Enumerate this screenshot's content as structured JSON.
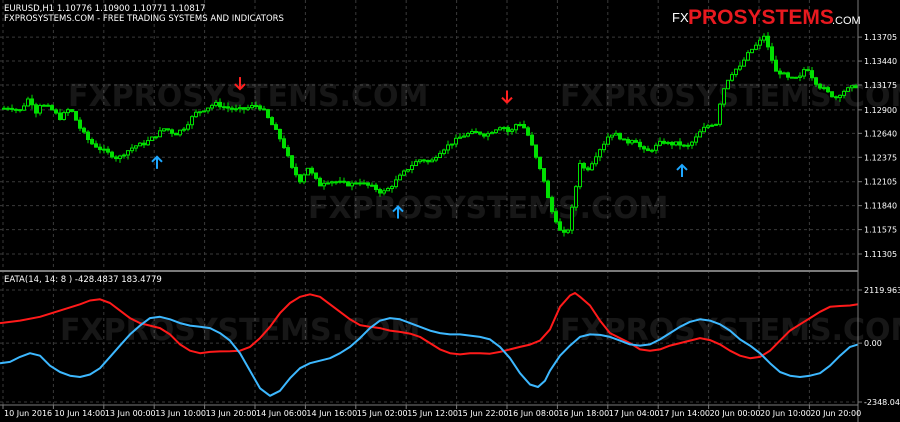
{
  "header": {
    "symbol_line": "EURUSD,H1  1.10776 1.10900 1.10771 1.10817",
    "site_line": "FXPROSYSTEMS.COM - FREE TRADING SYSTEMS AND INDICATORS"
  },
  "logo": {
    "fx": "FX",
    "pro": "PROSYSTEMS",
    "com": ".COM"
  },
  "watermark": "FXPROSYSTEMS.COM",
  "indicator": {
    "label": "EATA(14, 14: 8 ) -428.4837 183.4779"
  },
  "colors": {
    "background": "#000000",
    "grid": "#3a3a3a",
    "candle": "#00e000",
    "buy_arrow": "#1ea7ff",
    "sell_arrow": "#ff2020",
    "red_line": "#ff1a1a",
    "blue_line": "#3db8ff",
    "logo_red": "#e8191f"
  },
  "chart_data": [
    {
      "type": "candlestick",
      "title": "EURUSD,H1",
      "ylim": [
        1.1115,
        1.1385
      ],
      "y_ticks": [
        "1.13705",
        "1.13440",
        "1.13175",
        "1.12900",
        "1.12640",
        "1.12375",
        "1.12105",
        "1.11840",
        "1.11575",
        "1.11305"
      ],
      "close_path": [
        [
          0,
          1.1291
        ],
        [
          10,
          1.1293
        ],
        [
          20,
          1.1289
        ],
        [
          30,
          1.1305
        ],
        [
          35,
          1.1286
        ],
        [
          40,
          1.1296
        ],
        [
          50,
          1.1292
        ],
        [
          60,
          1.1281
        ],
        [
          70,
          1.1292
        ],
        [
          80,
          1.127
        ],
        [
          90,
          1.1254
        ],
        [
          100,
          1.1247
        ],
        [
          110,
          1.1241
        ],
        [
          118,
          1.1236
        ],
        [
          125,
          1.1243
        ],
        [
          135,
          1.125
        ],
        [
          145,
          1.1253
        ],
        [
          155,
          1.1261
        ],
        [
          165,
          1.127
        ],
        [
          175,
          1.1263
        ],
        [
          185,
          1.1271
        ],
        [
          195,
          1.1286
        ],
        [
          205,
          1.1291
        ],
        [
          215,
          1.1297
        ],
        [
          225,
          1.1293
        ],
        [
          235,
          1.129
        ],
        [
          245,
          1.1291
        ],
        [
          255,
          1.1295
        ],
        [
          262,
          1.1292
        ],
        [
          270,
          1.1277
        ],
        [
          278,
          1.1263
        ],
        [
          285,
          1.1247
        ],
        [
          292,
          1.1225
        ],
        [
          300,
          1.1212
        ],
        [
          308,
          1.1226
        ],
        [
          315,
          1.1214
        ],
        [
          320,
          1.1207
        ],
        [
          325,
          1.1211
        ],
        [
          333,
          1.1211
        ],
        [
          342,
          1.1209
        ],
        [
          350,
          1.1207
        ],
        [
          358,
          1.1211
        ],
        [
          366,
          1.1207
        ],
        [
          374,
          1.1204
        ],
        [
          382,
          1.1198
        ],
        [
          390,
          1.1204
        ],
        [
          398,
          1.1214
        ],
        [
          406,
          1.1223
        ],
        [
          414,
          1.1231
        ],
        [
          422,
          1.1236
        ],
        [
          430,
          1.1231
        ],
        [
          438,
          1.1242
        ],
        [
          446,
          1.1249
        ],
        [
          454,
          1.1255
        ],
        [
          462,
          1.1261
        ],
        [
          470,
          1.1264
        ],
        [
          478,
          1.1265
        ],
        [
          486,
          1.1262
        ],
        [
          494,
          1.1268
        ],
        [
          502,
          1.1273
        ],
        [
          510,
          1.1264
        ],
        [
          518,
          1.1277
        ],
        [
          526,
          1.1268
        ],
        [
          532,
          1.125
        ],
        [
          538,
          1.123
        ],
        [
          544,
          1.1212
        ],
        [
          550,
          1.1182
        ],
        [
          556,
          1.1168
        ],
        [
          562,
          1.115
        ],
        [
          568,
          1.1158
        ],
        [
          574,
          1.1192
        ],
        [
          580,
          1.1232
        ],
        [
          586,
          1.1222
        ],
        [
          592,
          1.1232
        ],
        [
          598,
          1.1244
        ],
        [
          604,
          1.1253
        ],
        [
          610,
          1.1264
        ],
        [
          618,
          1.1262
        ],
        [
          626,
          1.1253
        ],
        [
          634,
          1.1259
        ],
        [
          640,
          1.1249
        ],
        [
          646,
          1.1243
        ],
        [
          654,
          1.1248
        ],
        [
          662,
          1.1255
        ],
        [
          670,
          1.1252
        ],
        [
          678,
          1.1253
        ],
        [
          686,
          1.1248
        ],
        [
          694,
          1.1256
        ],
        [
          702,
          1.1268
        ],
        [
          710,
          1.1274
        ],
        [
          716,
          1.1275
        ],
        [
          722,
          1.1309
        ],
        [
          728,
          1.1324
        ],
        [
          734,
          1.1334
        ],
        [
          740,
          1.1337
        ],
        [
          746,
          1.1349
        ],
        [
          752,
          1.1357
        ],
        [
          758,
          1.1363
        ],
        [
          764,
          1.1372
        ],
        [
          770,
          1.1352
        ],
        [
          776,
          1.1332
        ],
        [
          782,
          1.1331
        ],
        [
          788,
          1.1325
        ],
        [
          794,
          1.1324
        ],
        [
          800,
          1.1326
        ],
        [
          806,
          1.1339
        ],
        [
          812,
          1.1327
        ],
        [
          818,
          1.1317
        ],
        [
          824,
          1.1313
        ],
        [
          830,
          1.1307
        ],
        [
          836,
          1.1304
        ],
        [
          842,
          1.131
        ],
        [
          850,
          1.1314
        ],
        [
          858,
          1.1317
        ]
      ],
      "buy_arrows": [
        [
          157,
          1.1238
        ],
        [
          398,
          1.1183
        ],
        [
          682,
          1.1229
        ]
      ],
      "sell_arrows": [
        [
          240,
          1.1313
        ],
        [
          507,
          1.1298
        ]
      ]
    },
    {
      "type": "line",
      "title": "EATA(14, 14: 8 )",
      "ylim": [
        -2348.042,
        2119.963
      ],
      "y_ticks": [
        "2119.963",
        "0.00",
        "-2348.042"
      ],
      "x_tick_labels": [
        "10 Jun 2016",
        "10 Jun 14:00",
        "13 Jun 00:00",
        "13 Jun 10:00",
        "13 Jun 20:00",
        "14 Jun 06:00",
        "14 Jun 16:00",
        "15 Jun 02:00",
        "15 Jun 12:00",
        "15 Jun 22:00",
        "16 Jun 08:00",
        "16 Jun 18:00",
        "17 Jun 04:00",
        "17 Jun 14:00",
        "20 Jun 00:00",
        "20 Jun 10:00",
        "20 Jun 20:00"
      ],
      "series": [
        {
          "color": "red",
          "points": [
            [
              0,
              800
            ],
            [
              20,
              900
            ],
            [
              40,
              1050
            ],
            [
              60,
              1300
            ],
            [
              80,
              1550
            ],
            [
              90,
              1700
            ],
            [
              100,
              1750
            ],
            [
              110,
              1600
            ],
            [
              120,
              1300
            ],
            [
              130,
              1000
            ],
            [
              140,
              800
            ],
            [
              150,
              700
            ],
            [
              160,
              600
            ],
            [
              170,
              350
            ],
            [
              180,
              -50
            ],
            [
              190,
              -300
            ],
            [
              200,
              -400
            ],
            [
              210,
              -350
            ],
            [
              220,
              -330
            ],
            [
              230,
              -320
            ],
            [
              240,
              -300
            ],
            [
              250,
              -150
            ],
            [
              260,
              200
            ],
            [
              270,
              650
            ],
            [
              280,
              1200
            ],
            [
              290,
              1600
            ],
            [
              300,
              1850
            ],
            [
              310,
              1950
            ],
            [
              320,
              1850
            ],
            [
              330,
              1550
            ],
            [
              340,
              1250
            ],
            [
              350,
              950
            ],
            [
              360,
              720
            ],
            [
              370,
              650
            ],
            [
              380,
              600
            ],
            [
              390,
              500
            ],
            [
              400,
              450
            ],
            [
              410,
              380
            ],
            [
              420,
              250
            ],
            [
              430,
              0
            ],
            [
              440,
              -250
            ],
            [
              450,
              -400
            ],
            [
              460,
              -450
            ],
            [
              470,
              -400
            ],
            [
              480,
              -400
            ],
            [
              490,
              -420
            ],
            [
              500,
              -350
            ],
            [
              510,
              -250
            ],
            [
              520,
              -150
            ],
            [
              530,
              -60
            ],
            [
              540,
              100
            ],
            [
              550,
              550
            ],
            [
              560,
              1450
            ],
            [
              570,
              1900
            ],
            [
              575,
              2000
            ],
            [
              580,
              1850
            ],
            [
              590,
              1500
            ],
            [
              600,
              900
            ],
            [
              610,
              400
            ],
            [
              620,
              200
            ],
            [
              630,
              0
            ],
            [
              640,
              -250
            ],
            [
              650,
              -300
            ],
            [
              660,
              -250
            ],
            [
              670,
              -100
            ],
            [
              680,
              0
            ],
            [
              690,
              100
            ],
            [
              700,
              200
            ],
            [
              710,
              120
            ],
            [
              720,
              -50
            ],
            [
              730,
              -300
            ],
            [
              740,
              -500
            ],
            [
              750,
              -600
            ],
            [
              760,
              -550
            ],
            [
              770,
              -300
            ],
            [
              780,
              100
            ],
            [
              790,
              500
            ],
            [
              800,
              750
            ],
            [
              810,
              1000
            ],
            [
              820,
              1250
            ],
            [
              830,
              1450
            ],
            [
              840,
              1480
            ],
            [
              850,
              1500
            ],
            [
              858,
              1550
            ]
          ]
        },
        {
          "color": "blue",
          "points": [
            [
              0,
              -800
            ],
            [
              10,
              -750
            ],
            [
              20,
              -550
            ],
            [
              30,
              -400
            ],
            [
              40,
              -500
            ],
            [
              50,
              -900
            ],
            [
              60,
              -1150
            ],
            [
              70,
              -1300
            ],
            [
              80,
              -1350
            ],
            [
              90,
              -1250
            ],
            [
              100,
              -1000
            ],
            [
              110,
              -550
            ],
            [
              120,
              -100
            ],
            [
              130,
              350
            ],
            [
              140,
              700
            ],
            [
              150,
              1000
            ],
            [
              160,
              1050
            ],
            [
              170,
              950
            ],
            [
              180,
              800
            ],
            [
              190,
              700
            ],
            [
              200,
              650
            ],
            [
              210,
              600
            ],
            [
              220,
              400
            ],
            [
              230,
              100
            ],
            [
              240,
              -400
            ],
            [
              250,
              -1100
            ],
            [
              260,
              -1800
            ],
            [
              270,
              -2100
            ],
            [
              280,
              -1900
            ],
            [
              290,
              -1400
            ],
            [
              300,
              -1000
            ],
            [
              310,
              -800
            ],
            [
              320,
              -700
            ],
            [
              330,
              -600
            ],
            [
              340,
              -400
            ],
            [
              350,
              -150
            ],
            [
              360,
              200
            ],
            [
              370,
              600
            ],
            [
              380,
              900
            ],
            [
              390,
              1000
            ],
            [
              400,
              950
            ],
            [
              410,
              800
            ],
            [
              420,
              650
            ],
            [
              430,
              500
            ],
            [
              440,
              400
            ],
            [
              450,
              350
            ],
            [
              460,
              350
            ],
            [
              470,
              300
            ],
            [
              480,
              250
            ],
            [
              490,
              150
            ],
            [
              500,
              -150
            ],
            [
              510,
              -600
            ],
            [
              520,
              -1200
            ],
            [
              530,
              -1650
            ],
            [
              538,
              -1750
            ],
            [
              545,
              -1500
            ],
            [
              550,
              -1100
            ],
            [
              560,
              -500
            ],
            [
              570,
              -100
            ],
            [
              580,
              250
            ],
            [
              590,
              350
            ],
            [
              600,
              330
            ],
            [
              610,
              250
            ],
            [
              620,
              100
            ],
            [
              630,
              -50
            ],
            [
              640,
              -100
            ],
            [
              650,
              -50
            ],
            [
              660,
              150
            ],
            [
              670,
              400
            ],
            [
              680,
              650
            ],
            [
              690,
              850
            ],
            [
              700,
              950
            ],
            [
              710,
              900
            ],
            [
              720,
              750
            ],
            [
              730,
              500
            ],
            [
              740,
              150
            ],
            [
              750,
              -100
            ],
            [
              760,
              -400
            ],
            [
              770,
              -800
            ],
            [
              780,
              -1150
            ],
            [
              790,
              -1300
            ],
            [
              800,
              -1350
            ],
            [
              810,
              -1300
            ],
            [
              820,
              -1200
            ],
            [
              830,
              -900
            ],
            [
              840,
              -500
            ],
            [
              850,
              -150
            ],
            [
              858,
              -50
            ]
          ]
        }
      ]
    }
  ]
}
